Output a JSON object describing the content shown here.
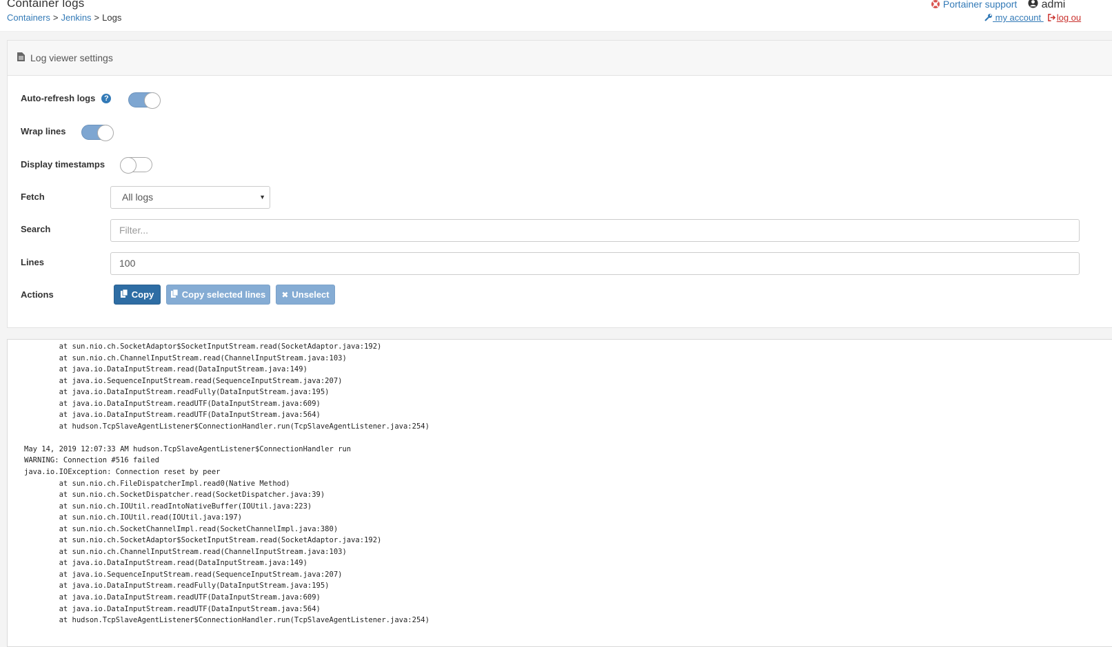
{
  "header": {
    "title": "Container logs",
    "breadcrumb": {
      "containers": "Containers",
      "jenkins": "Jenkins",
      "current": "Logs",
      "sep": ">"
    },
    "support_label": "Portainer support",
    "user_label": "admi",
    "my_account_label": " my account ",
    "logout_label": "log ou"
  },
  "settings": {
    "panel_title": "Log viewer settings",
    "auto_refresh_label": "Auto-refresh logs",
    "auto_refresh_on": true,
    "wrap_lines_label": "Wrap lines",
    "wrap_lines_on": true,
    "timestamps_label": "Display timestamps",
    "timestamps_on": false,
    "fetch_label": "Fetch",
    "fetch_value": "All logs",
    "search_label": "Search",
    "search_placeholder": "Filter...",
    "lines_label": "Lines",
    "lines_value": "100",
    "actions_label": "Actions",
    "copy_label": "Copy",
    "copy_selected_label": "Copy selected lines",
    "unselect_label": "Unselect"
  },
  "colors": {
    "primary": "#2e6da4",
    "link": "#337ab7",
    "danger": "#c9302c",
    "switch_on": "#7ea6d1"
  },
  "icons": [
    "file-text-icon",
    "question-circle-icon",
    "life-ring-icon",
    "user-circle-icon",
    "wrench-icon",
    "sign-out-icon",
    "copy-icon",
    "times-icon",
    "caret-down-icon"
  ],
  "log": {
    "lines": [
      "        at sun.nio.ch.SocketAdaptor$SocketInputStream.read(SocketAdaptor.java:192)",
      "        at sun.nio.ch.ChannelInputStream.read(ChannelInputStream.java:103)",
      "        at java.io.DataInputStream.read(DataInputStream.java:149)",
      "        at java.io.SequenceInputStream.read(SequenceInputStream.java:207)",
      "        at java.io.DataInputStream.readFully(DataInputStream.java:195)",
      "        at java.io.DataInputStream.readUTF(DataInputStream.java:609)",
      "        at java.io.DataInputStream.readUTF(DataInputStream.java:564)",
      "        at hudson.TcpSlaveAgentListener$ConnectionHandler.run(TcpSlaveAgentListener.java:254)",
      "",
      "May 14, 2019 12:07:33 AM hudson.TcpSlaveAgentListener$ConnectionHandler run",
      "WARNING: Connection #516 failed",
      "java.io.IOException: Connection reset by peer",
      "        at sun.nio.ch.FileDispatcherImpl.read0(Native Method)",
      "        at sun.nio.ch.SocketDispatcher.read(SocketDispatcher.java:39)",
      "        at sun.nio.ch.IOUtil.readIntoNativeBuffer(IOUtil.java:223)",
      "        at sun.nio.ch.IOUtil.read(IOUtil.java:197)",
      "        at sun.nio.ch.SocketChannelImpl.read(SocketChannelImpl.java:380)",
      "        at sun.nio.ch.SocketAdaptor$SocketInputStream.read(SocketAdaptor.java:192)",
      "        at sun.nio.ch.ChannelInputStream.read(ChannelInputStream.java:103)",
      "        at java.io.DataInputStream.read(DataInputStream.java:149)",
      "        at java.io.SequenceInputStream.read(SequenceInputStream.java:207)",
      "        at java.io.DataInputStream.readFully(DataInputStream.java:195)",
      "        at java.io.DataInputStream.readUTF(DataInputStream.java:609)",
      "        at java.io.DataInputStream.readUTF(DataInputStream.java:564)",
      "        at hudson.TcpSlaveAgentListener$ConnectionHandler.run(TcpSlaveAgentListener.java:254)"
    ]
  }
}
